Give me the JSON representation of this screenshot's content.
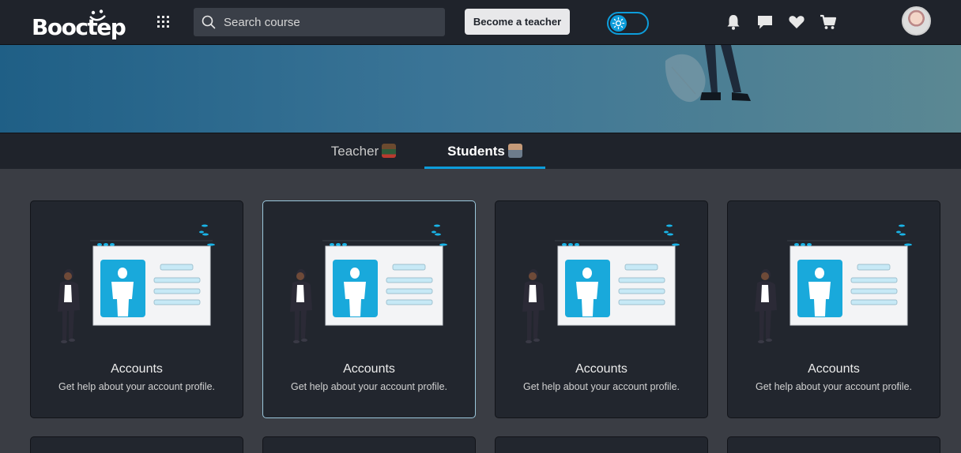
{
  "header": {
    "logo_text": "Booctep",
    "search_placeholder": "Search course",
    "become_teacher_label": "Become a teacher",
    "theme_toggle_icon": "sun-icon",
    "icons": [
      "bell-icon",
      "chat-icon",
      "heart-icon",
      "cart-icon"
    ]
  },
  "tabs": [
    {
      "label": "Teacher",
      "active": false
    },
    {
      "label": "Students",
      "active": true
    }
  ],
  "cards": [
    {
      "title": "Accounts",
      "description": "Get help about your account profile."
    },
    {
      "title": "Accounts",
      "description": "Get help about your account profile."
    },
    {
      "title": "Accounts",
      "description": "Get help about your account profile."
    },
    {
      "title": "Accounts",
      "description": "Get help about your account profile."
    }
  ],
  "colors": {
    "accent": "#0d9ddb",
    "navbar": "#1f232b",
    "page_bg": "#3a3d44",
    "card_bg": "#22262e"
  }
}
